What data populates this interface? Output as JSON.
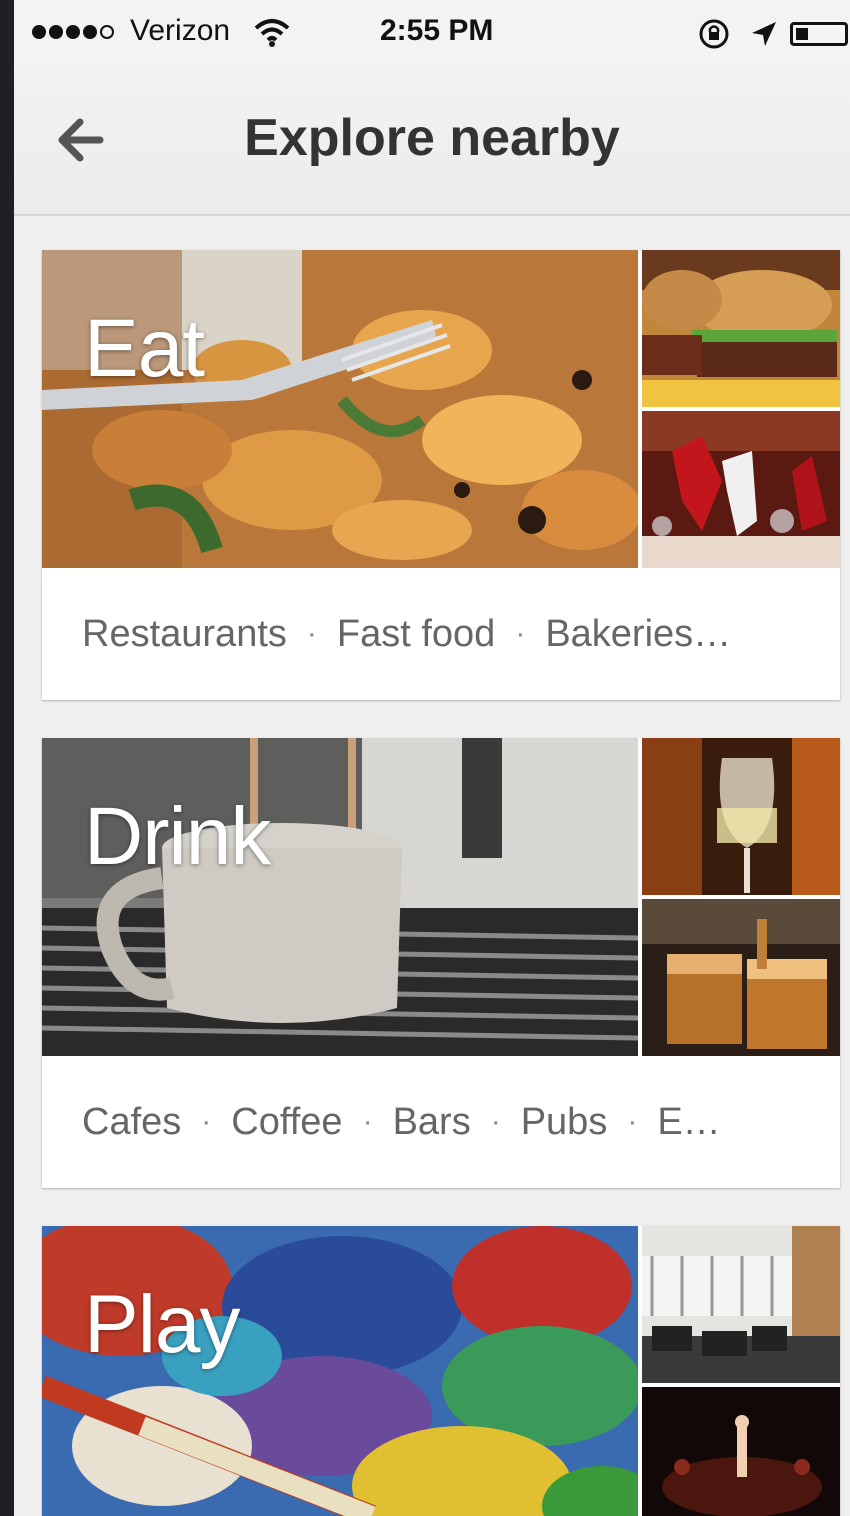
{
  "status_bar": {
    "signal_dots": [
      true,
      true,
      true,
      true,
      false
    ],
    "carrier": "Verizon",
    "time": "2:55 PM",
    "icons": [
      "wifi-icon",
      "rotation-lock-icon",
      "location-arrow-icon",
      "battery-icon"
    ]
  },
  "app_bar": {
    "back_icon": "back-arrow-icon",
    "title": "Explore nearby"
  },
  "cards": [
    {
      "heading": "Eat",
      "links": [
        "Restaurants",
        "Fast food",
        "Bakeries…"
      ],
      "images": [
        "pasta-photo",
        "burger-photo",
        "restaurant-table-photo"
      ]
    },
    {
      "heading": "Drink",
      "links": [
        "Cafes",
        "Coffee",
        "Bars",
        "Pubs",
        "E…"
      ],
      "images": [
        "espresso-cup-photo",
        "wine-glass-photo",
        "espresso-shots-photo"
      ]
    },
    {
      "heading": "Play",
      "links": [],
      "images": [
        "paint-palette-photo",
        "gym-treadmills-photo",
        "performance-stage-photo"
      ]
    }
  ],
  "separator": "·",
  "colors": {
    "background": "#efefef",
    "card": "#ffffff",
    "title_text": "#333333",
    "link_text": "#666666"
  }
}
